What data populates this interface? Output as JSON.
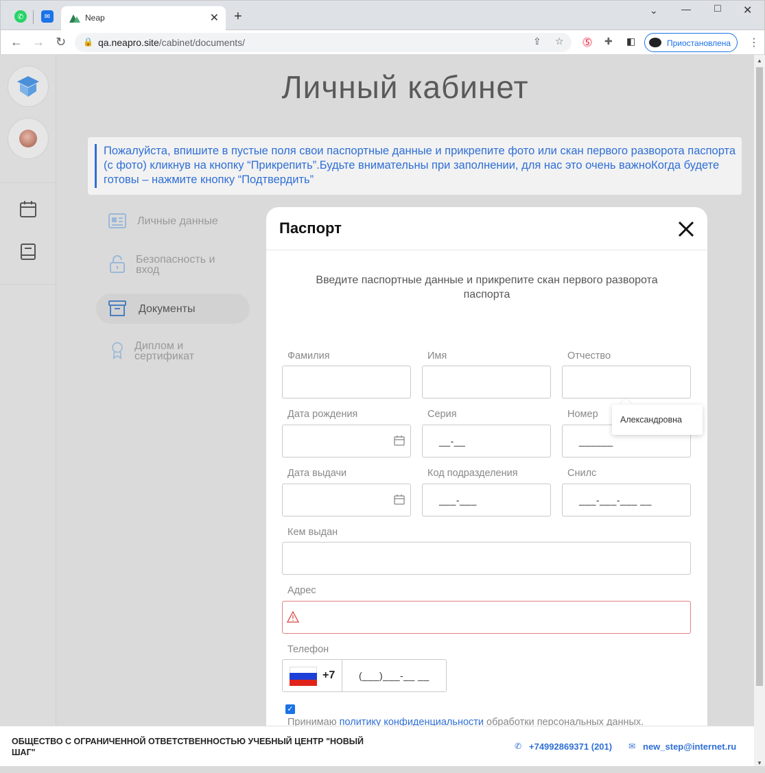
{
  "browser": {
    "tab_title": "Neap",
    "url_host": "qa.neapro.site",
    "url_path": "/cabinet/documents/",
    "profile_status": "Приостановлена",
    "new_tab": "+",
    "tab_close": "✕"
  },
  "page": {
    "title": "Личный кабинет",
    "notice": "Пожалуйста, впишите в пустые поля свои паспортные данные и прикрепите фото или скан первого разворота паспорта (с фото) кликнув на кнопку “Прикрепить”.Будьте внимательны при заполнении, для нас это очень важноКогда будете готовы – нажмите кнопку “Подтвердить”"
  },
  "menu": {
    "personal": "Личные данные",
    "security_line1": "Безопасность и",
    "security_line2": "вход",
    "documents": "Документы",
    "diploma_line1": "Диплом и",
    "diploma_line2": "сертификат"
  },
  "modal": {
    "title": "Паспорт",
    "subtitle": "Введите паспортные данные и прикрепите скан первого разворота паспорта",
    "fields": {
      "surname": {
        "label": "Фамилия",
        "value": ""
      },
      "name": {
        "label": "Имя",
        "value": ""
      },
      "patronymic": {
        "label": "Отчество",
        "value": ""
      },
      "birthdate": {
        "label": "Дата рождения",
        "value": ""
      },
      "series": {
        "label": "Серия",
        "mask": "__-__"
      },
      "number": {
        "label": "Номер",
        "mask": "______"
      },
      "issue_date": {
        "label": "Дата выдачи",
        "value": ""
      },
      "division_code": {
        "label": "Код подразделения",
        "mask": "___-___"
      },
      "snils": {
        "label": "Снилс",
        "mask": "___-___-___ __"
      },
      "issued_by": {
        "label": "Кем выдан",
        "value": ""
      },
      "address": {
        "label": "Адрес",
        "value": ""
      },
      "phone": {
        "label": "Телефон",
        "code": "+7",
        "mask": "(___)___-__ __"
      }
    },
    "autocomplete_suggestion": "Александровна",
    "consent": {
      "prefix": "Принимаю ",
      "link": "политику конфиденциальности",
      "suffix": " обработки персональных данных.",
      "checked": true
    }
  },
  "footer": {
    "company": "ОБЩЕСТВО С ОГРАНИЧЕННОЙ ОТВЕТСТВЕННОСТЬЮ УЧЕБНЫЙ ЦЕНТР \"НОВЫЙ ШАГ\"",
    "phone": "+74992869371 (201)",
    "email": "new_step@internet.ru"
  },
  "colors": {
    "accent": "#2f6fd6",
    "error_border": "#e48080",
    "overlay": "#dadada"
  }
}
